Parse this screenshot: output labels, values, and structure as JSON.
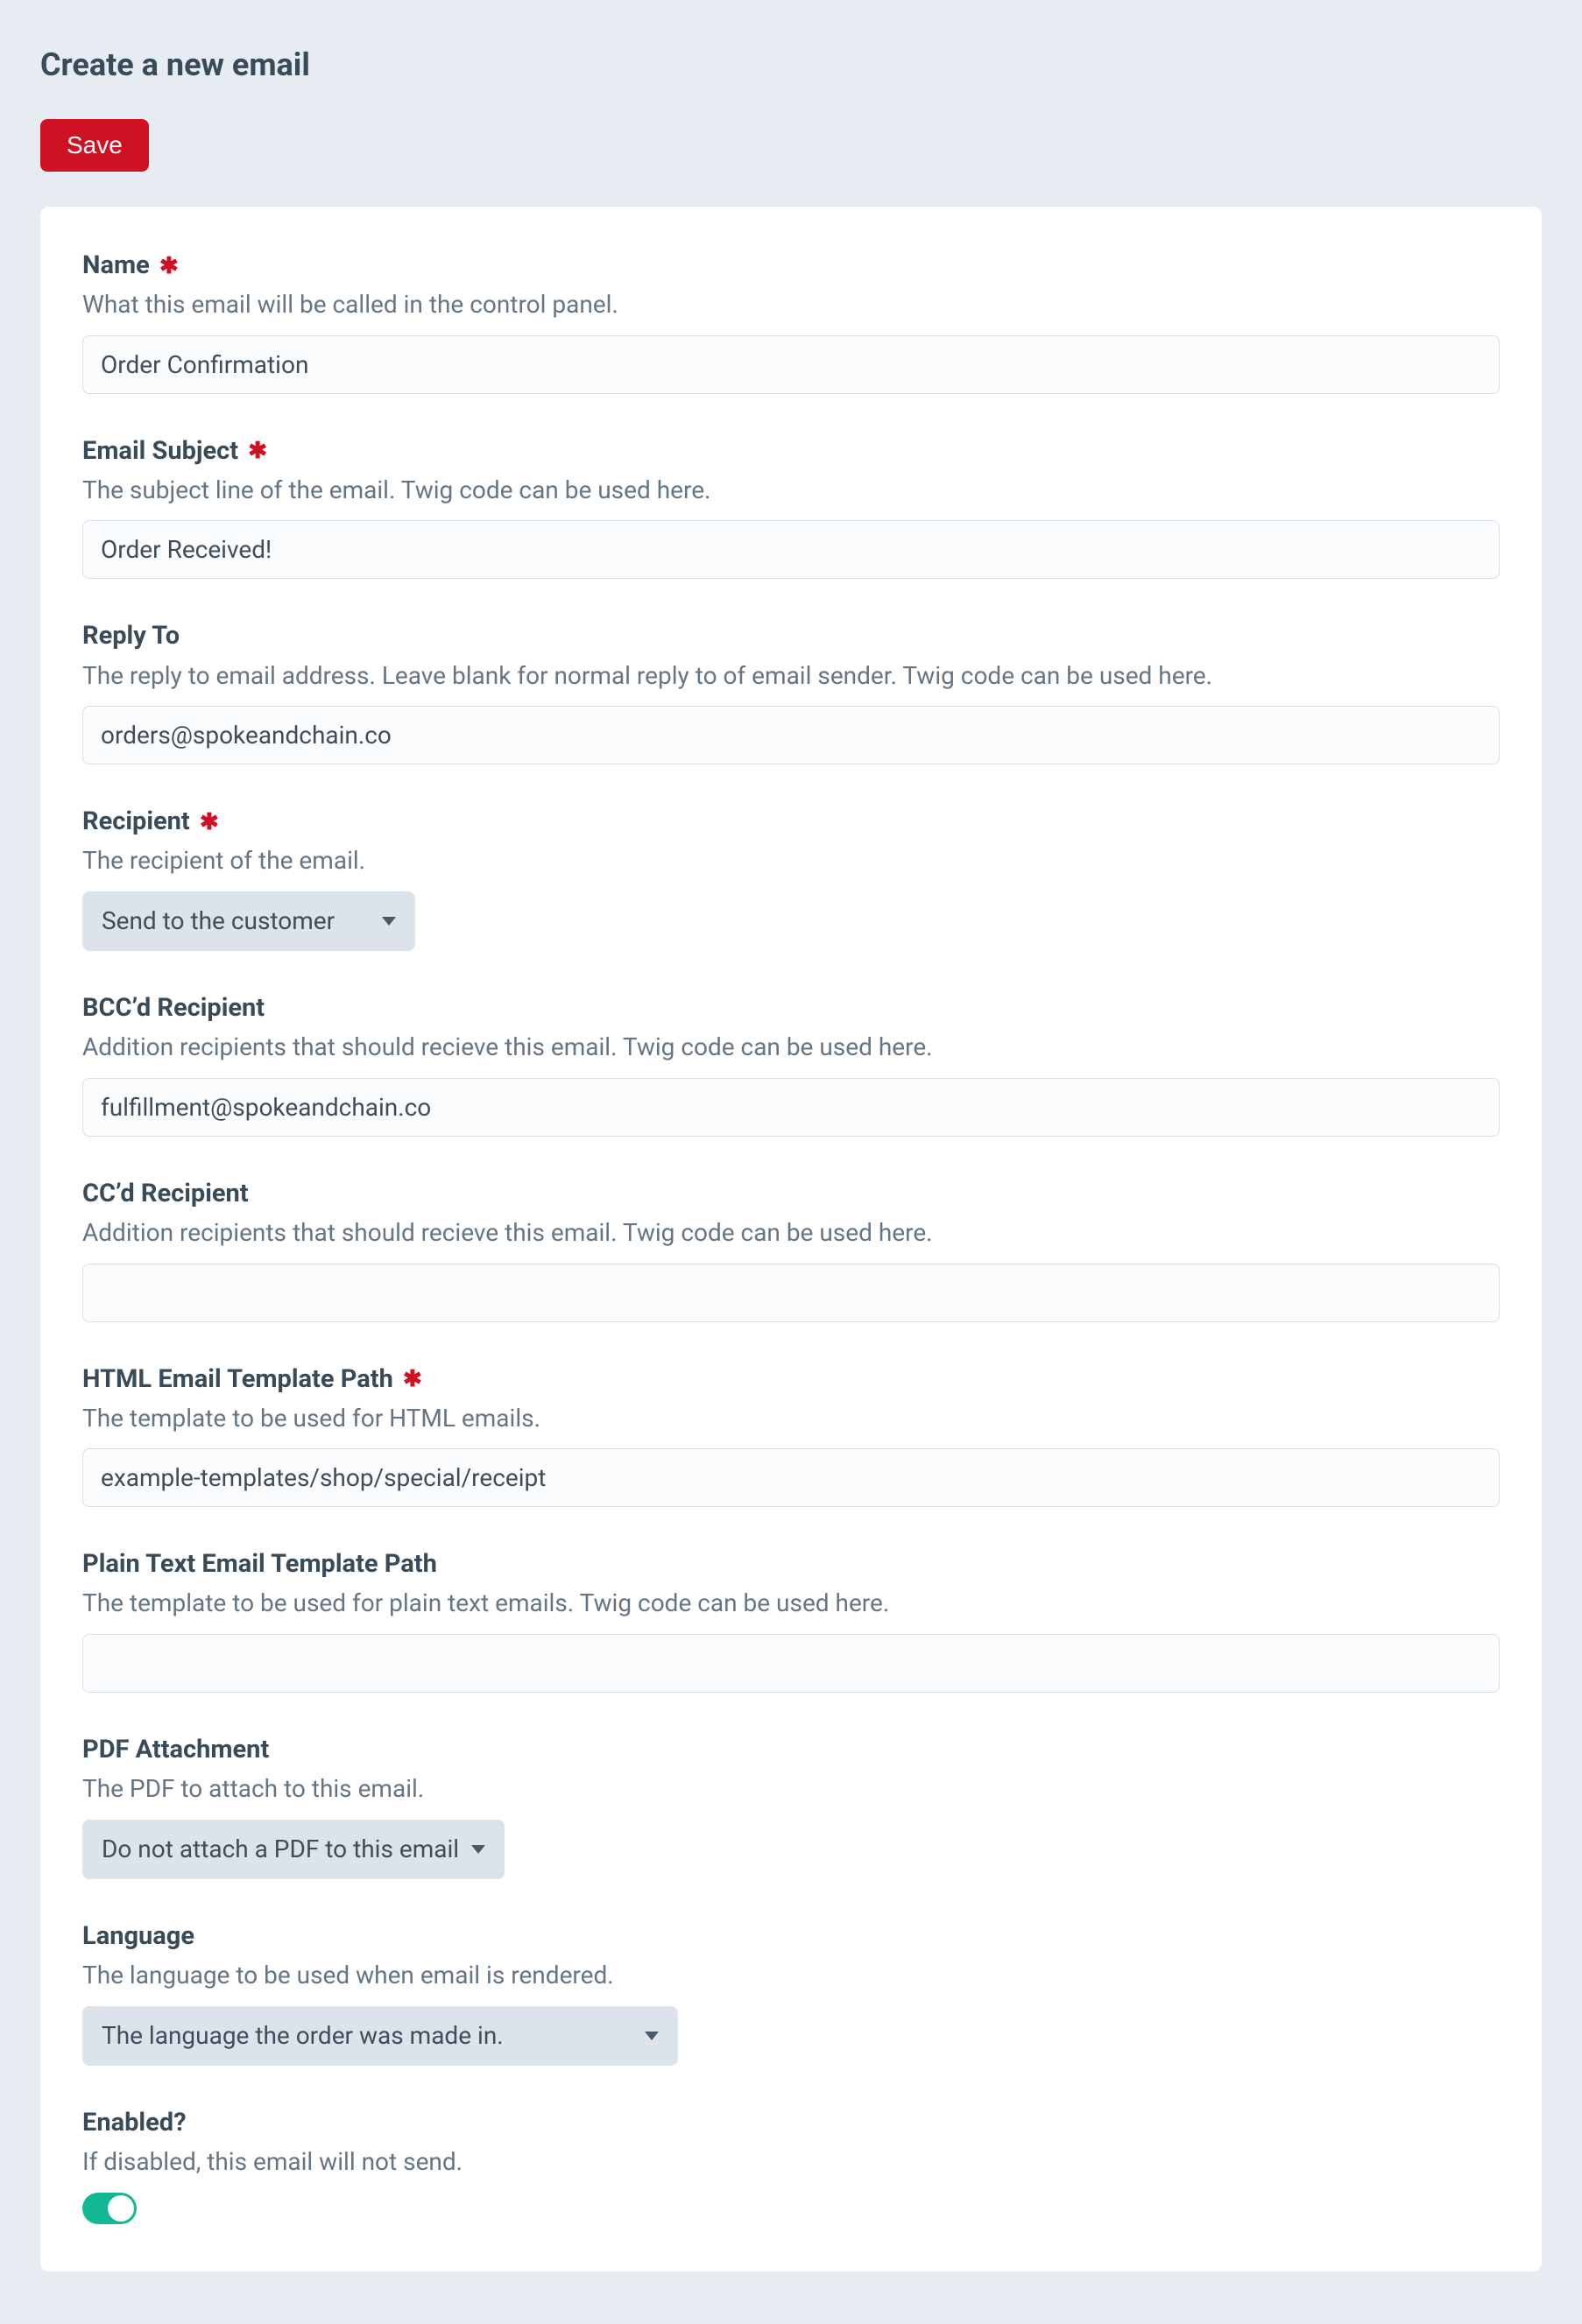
{
  "header": {
    "title": "Create a new email",
    "save_label": "Save"
  },
  "fields": {
    "name": {
      "label": "Name",
      "required": true,
      "help": "What this email will be called in the control panel.",
      "value": "Order Confirmation"
    },
    "subject": {
      "label": "Email Subject",
      "required": true,
      "help": "The subject line of the email. Twig code can be used here.",
      "value": "Order Received!"
    },
    "reply_to": {
      "label": "Reply To",
      "required": false,
      "help": "The reply to email address. Leave blank for normal reply to of email sender. Twig code can be used here.",
      "value": "orders@spokeandchain.co"
    },
    "recipient": {
      "label": "Recipient",
      "required": true,
      "help": "The recipient of the email.",
      "selected": "Send to the customer"
    },
    "bcc": {
      "label": "BCC’d Recipient",
      "required": false,
      "help": "Addition recipients that should recieve this email. Twig code can be used here.",
      "value": "fulfillment@spokeandchain.co"
    },
    "cc": {
      "label": "CC’d Recipient",
      "required": false,
      "help": "Addition recipients that should recieve this email. Twig code can be used here.",
      "value": ""
    },
    "html_template": {
      "label": "HTML Email Template Path",
      "required": true,
      "help": "The template to be used for HTML emails.",
      "value": "example-templates/shop/special/receipt"
    },
    "plain_template": {
      "label": "Plain Text Email Template Path",
      "required": false,
      "help": "The template to be used for plain text emails. Twig code can be used here.",
      "value": ""
    },
    "pdf": {
      "label": "PDF Attachment",
      "required": false,
      "help": "The PDF to attach to this email.",
      "selected": "Do not attach a PDF to this email"
    },
    "language": {
      "label": "Language",
      "required": false,
      "help": "The language to be used when email is rendered.",
      "selected": "The language the order was made in."
    },
    "enabled": {
      "label": "Enabled?",
      "required": false,
      "help": "If disabled, this email will not send.",
      "value": true
    }
  }
}
